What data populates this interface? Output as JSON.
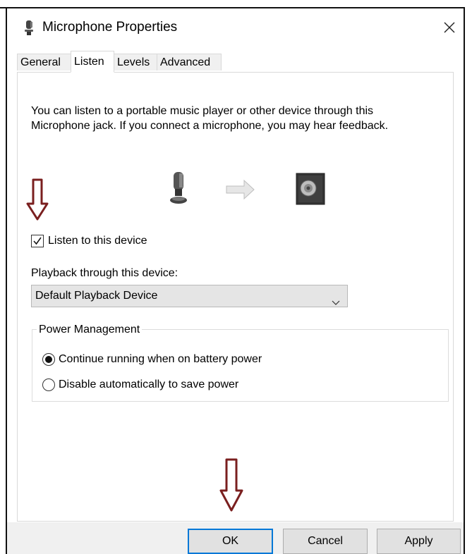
{
  "window": {
    "title": "Microphone Properties",
    "title_icon": "microphone-icon",
    "close_icon": "close-icon"
  },
  "tabs": [
    {
      "label": "General",
      "active": false
    },
    {
      "label": "Listen",
      "active": true
    },
    {
      "label": "Levels",
      "active": false
    },
    {
      "label": "Advanced",
      "active": false
    }
  ],
  "listen": {
    "description_line1": "You can listen to a portable music player or other device through this",
    "description_line2": "Microphone jack.  If you connect a microphone, you may hear feedback.",
    "diagram_icons": [
      "microphone-icon",
      "arrow-right-icon",
      "speaker-icon"
    ],
    "listen_checkbox_label": "Listen to this device",
    "listen_checked": true,
    "playback_label": "Playback through this device:",
    "playback_selected": "Default Playback Device"
  },
  "power": {
    "group_label": "Power Management",
    "options": [
      {
        "label": "Continue running when on battery power",
        "selected": true
      },
      {
        "label": "Disable automatically to save power",
        "selected": false
      }
    ]
  },
  "buttons": {
    "ok": "OK",
    "cancel": "Cancel",
    "apply": "Apply"
  },
  "annotations": {
    "arrow_color": "#7a1f1f"
  },
  "colors": {
    "accent": "#0078d7"
  }
}
